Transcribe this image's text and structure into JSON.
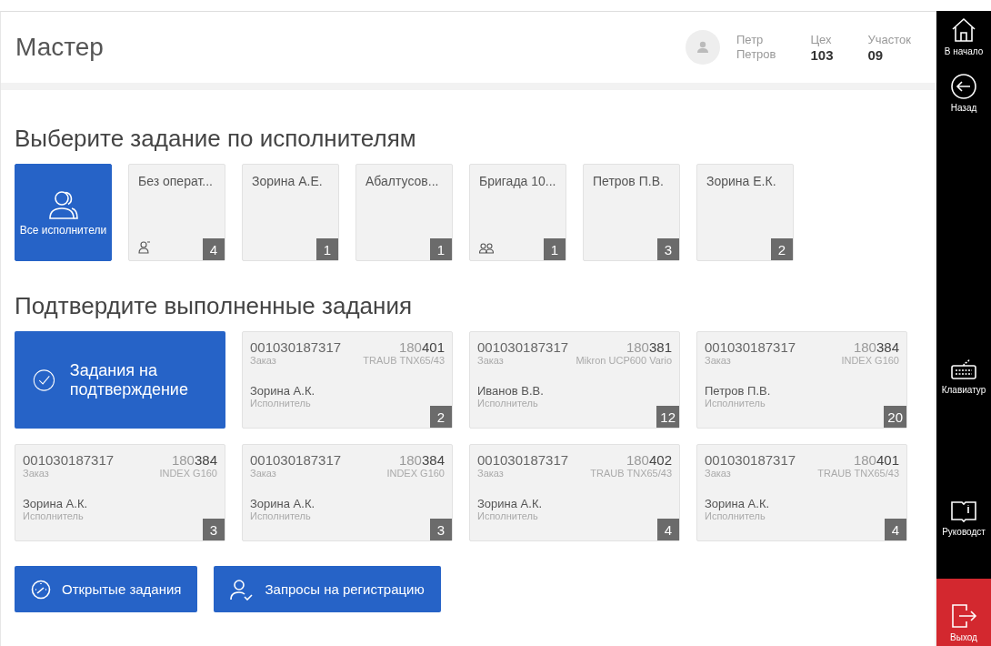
{
  "header": {
    "title": "Мастер",
    "user": {
      "first_name": "Петр",
      "last_name": "Петров"
    },
    "workshop": {
      "label": "Цех",
      "value": "103"
    },
    "section": {
      "label": "Участок",
      "value": "09"
    }
  },
  "executors": {
    "heading": "Выберите задание по исполнителям",
    "items": [
      {
        "kind": "all",
        "label": "Все исполнители",
        "selected": true
      },
      {
        "kind": "unassigned",
        "label": "Без операт...",
        "count": "4",
        "selected": false
      },
      {
        "kind": "person",
        "label": "Зорина А.Е.",
        "count": "1",
        "selected": false
      },
      {
        "kind": "person",
        "label": "Абалтусов...",
        "count": "1",
        "selected": false
      },
      {
        "kind": "brigade",
        "label": "Бригада 10...",
        "count": "1",
        "selected": false
      },
      {
        "kind": "person",
        "label": "Петров П.В.",
        "count": "3",
        "selected": false
      },
      {
        "kind": "person",
        "label": "Зорина Е.К.",
        "count": "2",
        "selected": false
      }
    ]
  },
  "confirm": {
    "heading": "Подтвердите выполненные задания",
    "main_button": "Задания на подтверждение",
    "tasks": [
      {
        "order": "001030187317",
        "number": "180**401**",
        "order_label": "Заказ",
        "machine": "TRAUB TNX65/43",
        "executor": "Зорина А.К.",
        "executor_label": "Исполнитель",
        "count": "2"
      },
      {
        "order": "001030187317",
        "number": "180**381**",
        "order_label": "Заказ",
        "machine": "Mikron UCP600 Vario",
        "executor": "Иванов В.В.",
        "executor_label": "Исполнитель",
        "count": "12"
      },
      {
        "order": "001030187317",
        "number": "180**384**",
        "order_label": "Заказ",
        "machine": "INDEX G160",
        "executor": "Петров П.В.",
        "executor_label": "Исполнитель",
        "count": "20"
      },
      {
        "order": "001030187317",
        "number": "180**384**",
        "order_label": "Заказ",
        "machine": "INDEX G160",
        "executor": "Зорина А.К.",
        "executor_label": "Исполнитель",
        "count": "3"
      },
      {
        "order": "001030187317",
        "number": "180**384**",
        "order_label": "Заказ",
        "machine": "INDEX G160",
        "executor": "Зорина А.К.",
        "executor_label": "Исполнитель",
        "count": "3"
      },
      {
        "order": "001030187317",
        "number": "180**402**",
        "order_label": "Заказ",
        "machine": "TRAUB TNX65/43",
        "executor": "Зорина А.К.",
        "executor_label": "Исполнитель",
        "count": "4"
      },
      {
        "order": "001030187317",
        "number": "180**401**",
        "order_label": "Заказ",
        "machine": "TRAUB TNX65/43",
        "executor": "Зорина А.К.",
        "executor_label": "Исполнитель",
        "count": "4"
      }
    ]
  },
  "actions": [
    {
      "kind": "open",
      "label": "Открытые задания"
    },
    {
      "kind": "registration",
      "label": "Запросы на регистрацию"
    }
  ],
  "sidebar": [
    {
      "kind": "home",
      "label": "В начало"
    },
    {
      "kind": "back",
      "label": "Назад"
    },
    {
      "kind": "keyboard",
      "label": "Клавиатур"
    },
    {
      "kind": "manual",
      "label": "Руководст"
    },
    {
      "kind": "exit",
      "label": "Выход"
    }
  ]
}
